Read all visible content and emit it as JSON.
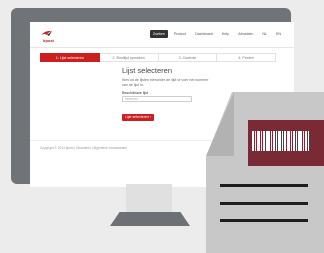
{
  "colors": {
    "brand_red": "#cc1f1f",
    "monitor_gray": "#707378",
    "document_gray": "#c8c8c8",
    "label_dark": "#7a2a35"
  },
  "header": {
    "logo_text": "bpost",
    "nav": [
      "Zoeken",
      "Product",
      "Dashboard",
      "Help",
      "Afmelden",
      "NL",
      "EN"
    ]
  },
  "steps": [
    "1. Lijst selecteren",
    "2. Bindlijst opmaken",
    "3. Controle",
    "4. Printen"
  ],
  "main": {
    "title": "Lijst selecteren",
    "description": "Kies uit de lijsten hieronder de lijst of voer het nummer van de lijst in.",
    "field_label": "Beschikbare lijst",
    "field_placeholder": "Nummer",
    "button_label": "Lijst selecteren ›"
  },
  "footer": {
    "copyright": "Copyright © 2014 bpost  |  Disclaimer  |  Algemene voorwaarden"
  },
  "icons": [
    "logo-icon",
    "barcode-icon",
    "document-icon"
  ]
}
